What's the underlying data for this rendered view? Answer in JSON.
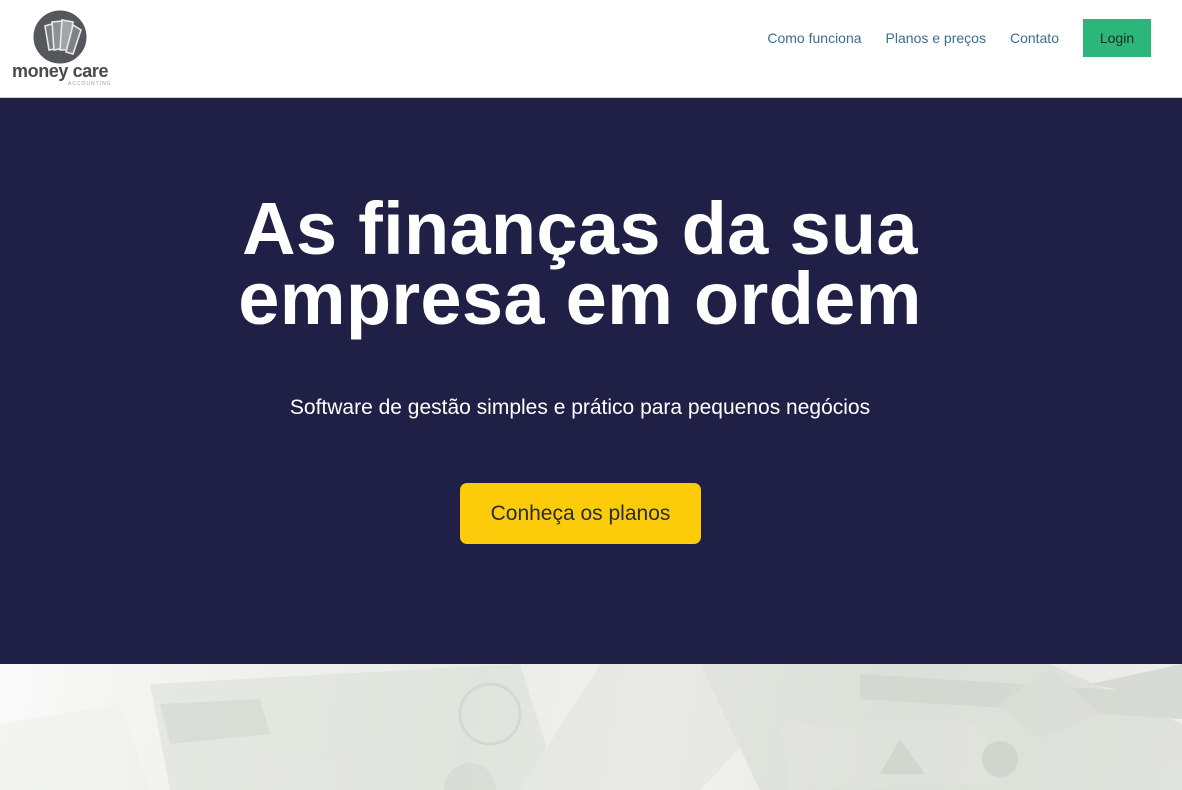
{
  "brand": {
    "name": "money care",
    "tagline": "ACCOUNTING",
    "logo_icon": "money-logo-icon"
  },
  "nav": {
    "links": [
      {
        "label": "Como funciona"
      },
      {
        "label": "Planos e preços"
      },
      {
        "label": "Contato"
      }
    ],
    "login_label": "Login"
  },
  "hero": {
    "title_line1": "As finanças da sua",
    "title_line2": "empresa em ordem",
    "subtitle": "Software de gestão simples e prático para pequenos negócios",
    "cta_label": "Conheça os planos"
  },
  "colors": {
    "hero_bg": "#202046",
    "login_bg": "#2db67a",
    "cta_bg": "#fccc0a",
    "nav_link": "#3b6f8e",
    "logo_gray": "#4a4a4a"
  }
}
